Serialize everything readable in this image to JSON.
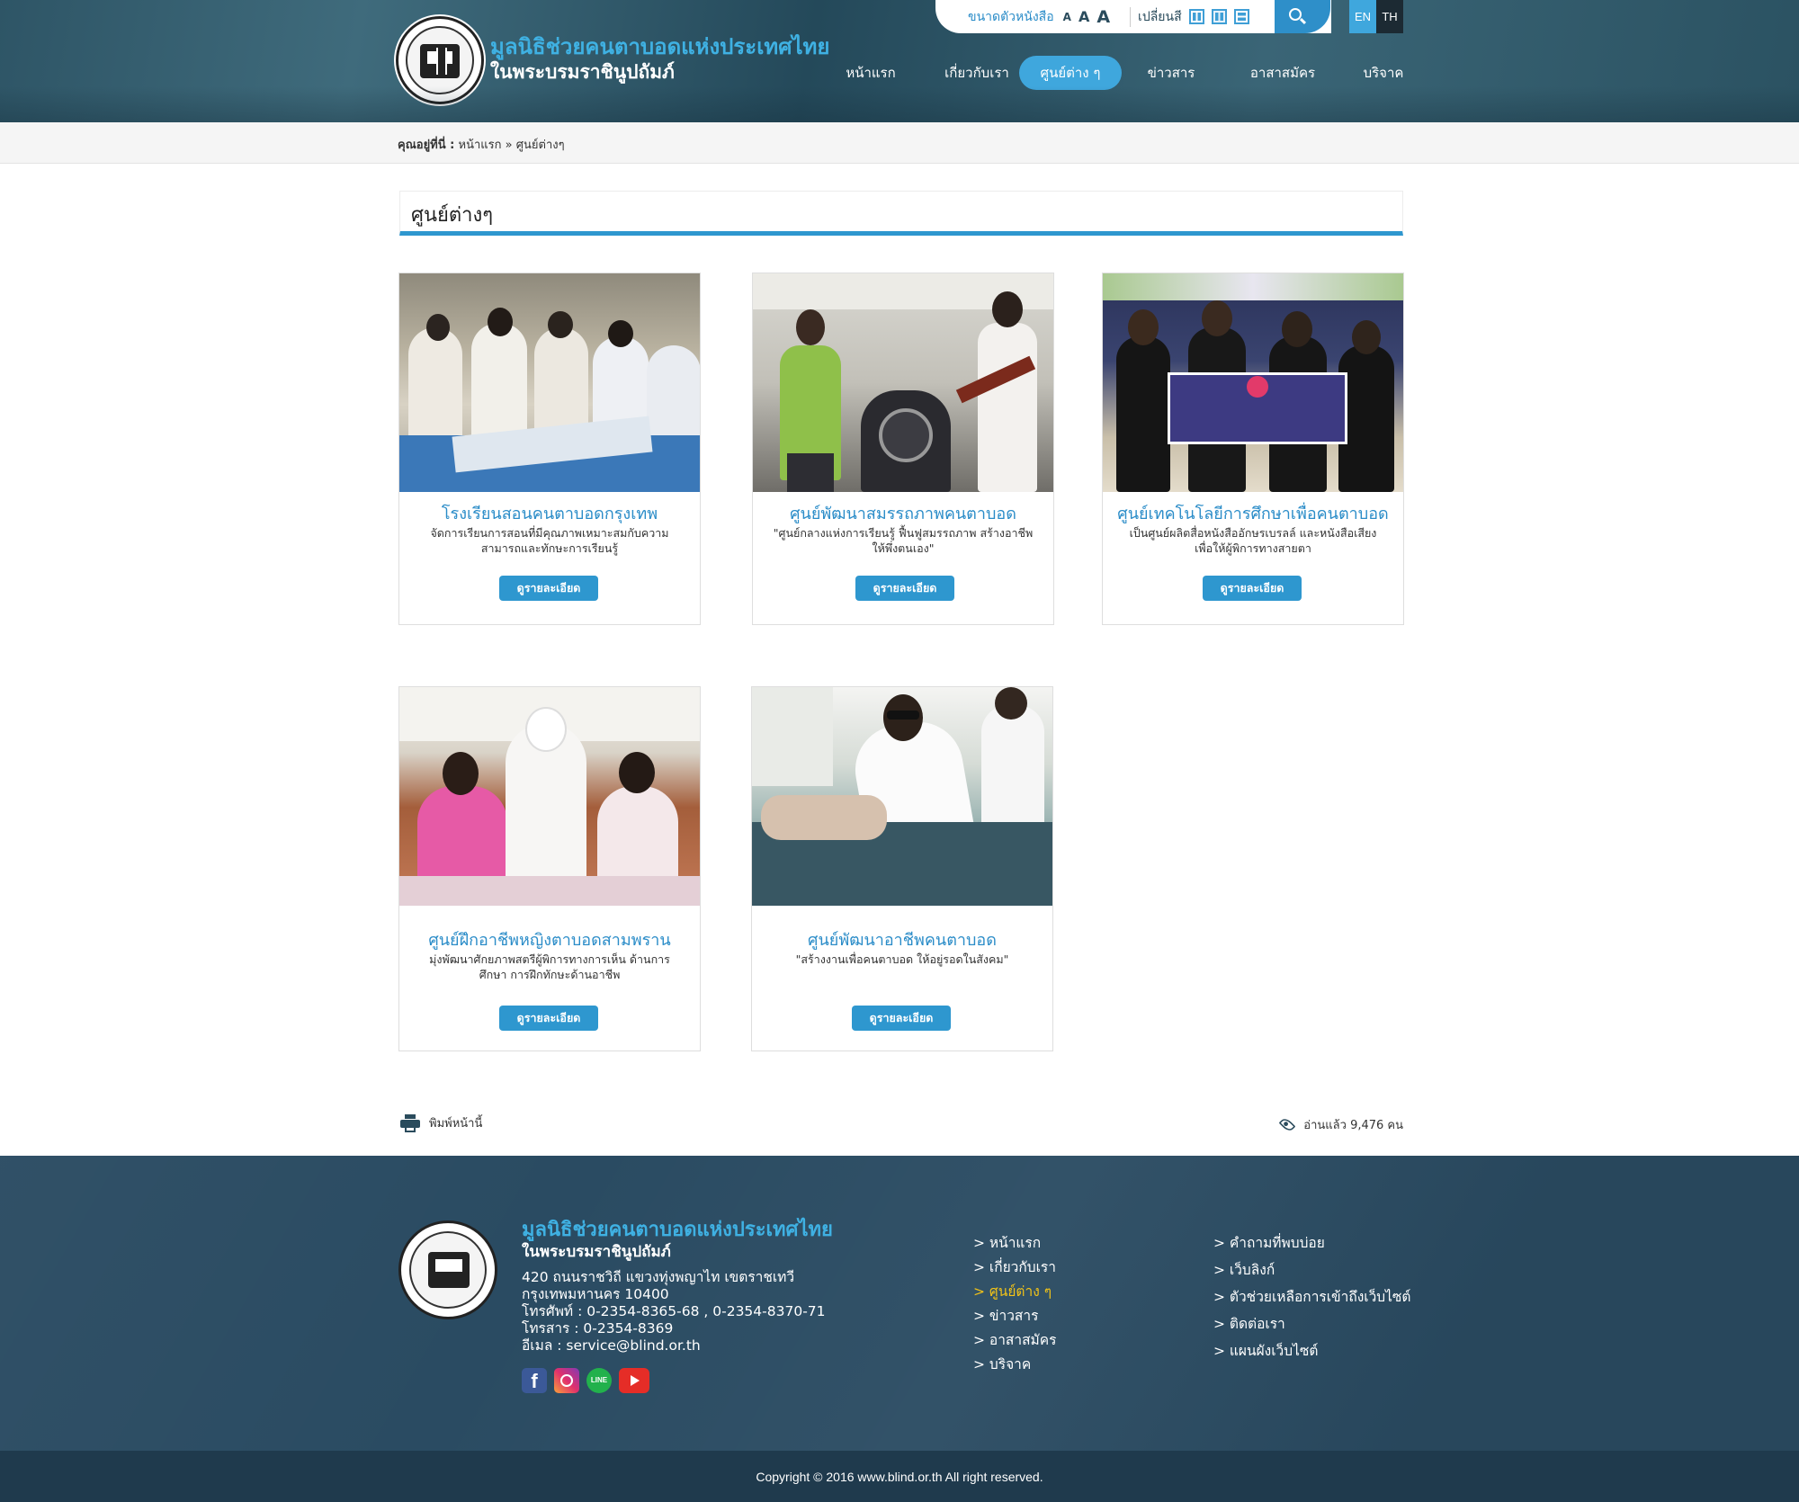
{
  "header": {
    "title_line1": "มูลนิธิช่วยคนตาบอดแห่งประเทศไทย",
    "title_line2": "ในพระบรมราชินูปถัมภ์",
    "font_size_label": "ขนาดตัวหนังสือ",
    "font_sizes": [
      "A",
      "A",
      "A"
    ],
    "color_change_label": "เปลี่ยนสี",
    "lang_en": "EN",
    "lang_th": "TH"
  },
  "nav": [
    {
      "label": "หน้าแรก",
      "active": false
    },
    {
      "label": "เกี่ยวกับเรา",
      "active": false
    },
    {
      "label": "ศูนย์ต่าง ๆ",
      "active": true
    },
    {
      "label": "ข่าวสาร",
      "active": false
    },
    {
      "label": "อาสาสมัคร",
      "active": false
    },
    {
      "label": "บริจาค",
      "active": false
    }
  ],
  "breadcrumb": {
    "prefix": "คุณอยู่ที่นี่ :",
    "home": "หน้าแรก",
    "sep": "»",
    "current": "ศูนย์ต่างๆ"
  },
  "page_title": "ศูนย์ต่างๆ",
  "cards": [
    {
      "title": "โรงเรียนสอนคนตาบอดกรุงเทพ",
      "desc": "จัดการเรียนการสอนที่มีคุณภาพเหมาะสมกับความสามารถและทักษะการเรียนรู้",
      "button": "ดูรายละเอียด"
    },
    {
      "title": "ศูนย์พัฒนาสมรรถภาพคนตาบอด",
      "desc": "\"ศูนย์กลางแห่งการเรียนรู้ ฟื้นฟูสมรรถภาพ สร้างอาชีพให้พึ่งตนเอง\"",
      "button": "ดูรายละเอียด"
    },
    {
      "title": "ศูนย์เทคโนโลยีการศึกษาเพื่อคนตาบอด",
      "desc": "เป็นศูนย์ผลิตสื่อหนังสืออักษรเบรลล์ และหนังสือเสียง เพื่อให้ผู้พิการทางสายตา",
      "button": "ดูรายละเอียด"
    },
    {
      "title": "ศูนย์ฝึกอาชีพหญิงตาบอดสามพราน",
      "desc": "มุ่งพัฒนาศักยภาพสตรีผู้พิการทางการเห็น ด้านการศึกษา การฝึกทักษะด้านอาชีพ",
      "button": "ดูรายละเอียด"
    },
    {
      "title": "ศูนย์พัฒนาอาชีพคนตาบอด",
      "desc": "\"สร้างงานเพื่อคนตาบอด ให้อยู่รอดในสังคม\"",
      "button": "ดูรายละเอียด"
    }
  ],
  "tools": {
    "print_label": "พิมพ์หน้านี้",
    "views_label": "อ่านแล้ว 9,476 คน"
  },
  "footer": {
    "title_line1": "มูลนิธิช่วยคนตาบอดแห่งประเทศไทย",
    "title_line2": "ในพระบรมราชินูปถัมภ์",
    "address": [
      "420 ถนนราชวิถี แขวงทุ่งพญาไท เขตราชเทวี",
      "กรุงเทพมหานคร 10400",
      "โทรศัพท์ : 0-2354-8365-68 , 0-2354-8370-71",
      "โทรสาร : 0-2354-8369",
      "อีเมล : service@blind.or.th"
    ],
    "links_col1": [
      {
        "label": "> หน้าแรก",
        "active": false
      },
      {
        "label": "> เกี่ยวกับเรา",
        "active": false
      },
      {
        "label": "> ศูนย์ต่าง ๆ",
        "active": true
      },
      {
        "label": "> ข่าวสาร",
        "active": false
      },
      {
        "label": "> อาสาสมัคร",
        "active": false
      },
      {
        "label": "> บริจาค",
        "active": false
      }
    ],
    "links_col2": [
      {
        "label": "> คำถามที่พบบ่อย"
      },
      {
        "label": "> เว็บลิงก์"
      },
      {
        "label": "> ตัวช่วยเหลือการเข้าถึงเว็บไซต์"
      },
      {
        "label": "> ติดต่อเรา"
      },
      {
        "label": "> แผนผังเว็บไซต์"
      }
    ],
    "social_fb": "f",
    "social_line": "LINE",
    "copyright": "Copyright © 2016 www.blind.or.th All right reserved."
  },
  "colors": {
    "accent": "#2e97cf",
    "header_bg": "#2e5566",
    "footer_bg": "#2a4b62",
    "link_active": "#f2c318"
  }
}
